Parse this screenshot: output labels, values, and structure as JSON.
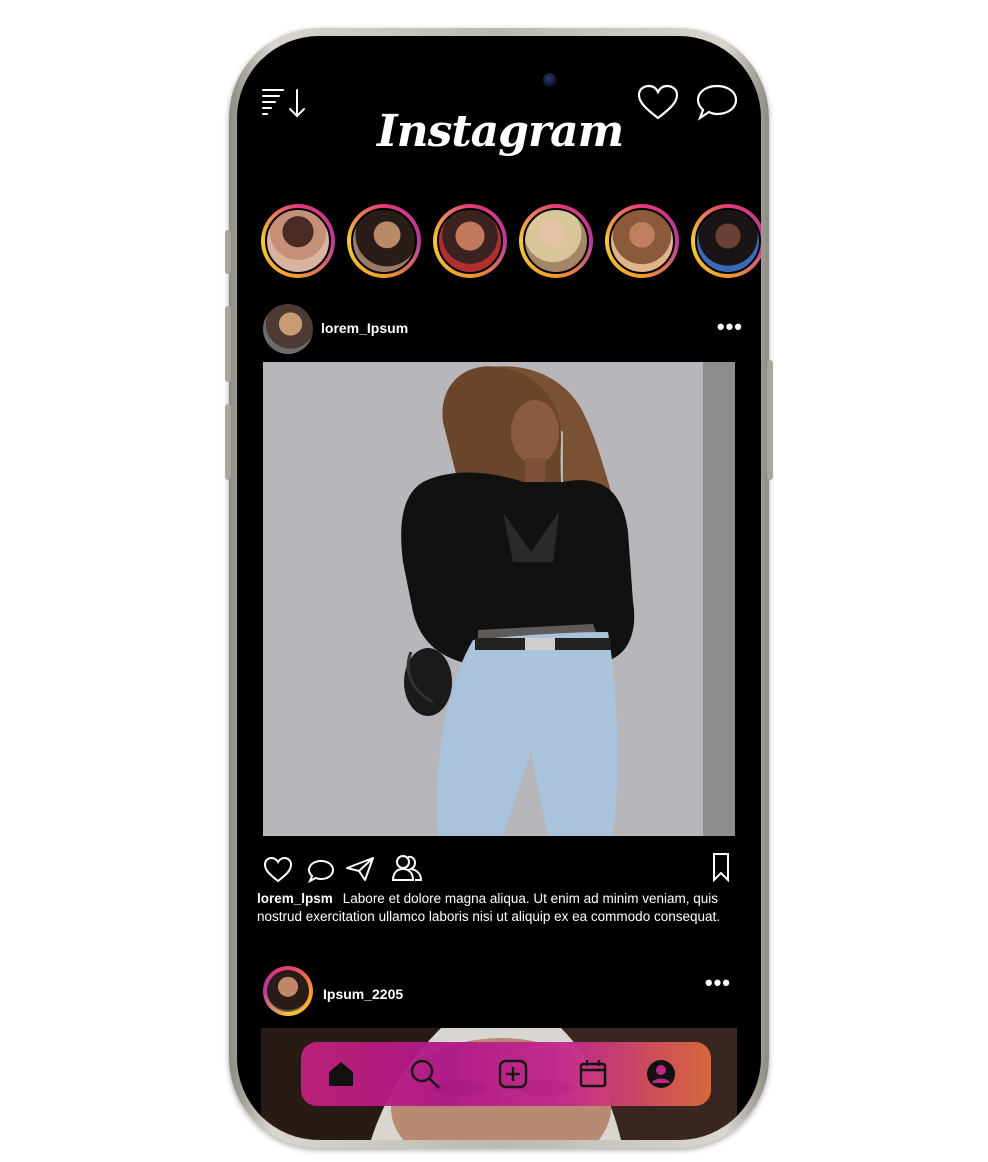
{
  "app": {
    "title": "Instagram"
  },
  "stories": [
    {
      "name": "story-1",
      "colors": [
        "#7a3b2c",
        "#d9b3a0"
      ]
    },
    {
      "name": "story-2",
      "colors": [
        "#2a1d18",
        "#b88b66"
      ]
    },
    {
      "name": "story-3",
      "colors": [
        "#5b2c20",
        "#c27a5f"
      ]
    },
    {
      "name": "story-4",
      "colors": [
        "#cfc7b2",
        "#a48767"
      ]
    },
    {
      "name": "story-5",
      "colors": [
        "#8a5a3a",
        "#e0b48a"
      ]
    },
    {
      "name": "story-6",
      "colors": [
        "#1b2a4a",
        "#7a5d58"
      ]
    }
  ],
  "post1": {
    "username": "lorem_Ipsum",
    "caption_user": "lorem_lpsm",
    "caption_text": "Labore et dolore magna aliqua. Ut enim ad minim veniam, quis nostrud exercitation ullamco laboris nisi ut aliquip ex ea commodo consequat.",
    "more": "•••"
  },
  "post2": {
    "username": "Ipsum_2205",
    "more": "•••"
  },
  "colors": {
    "background": "#000000",
    "text": "#ffffff",
    "nav_gradient_start": "#c2237d",
    "nav_gradient_end": "#e06c3e"
  },
  "nav": [
    "home-icon",
    "search-icon",
    "add-icon",
    "calendar-icon",
    "profile-icon"
  ]
}
